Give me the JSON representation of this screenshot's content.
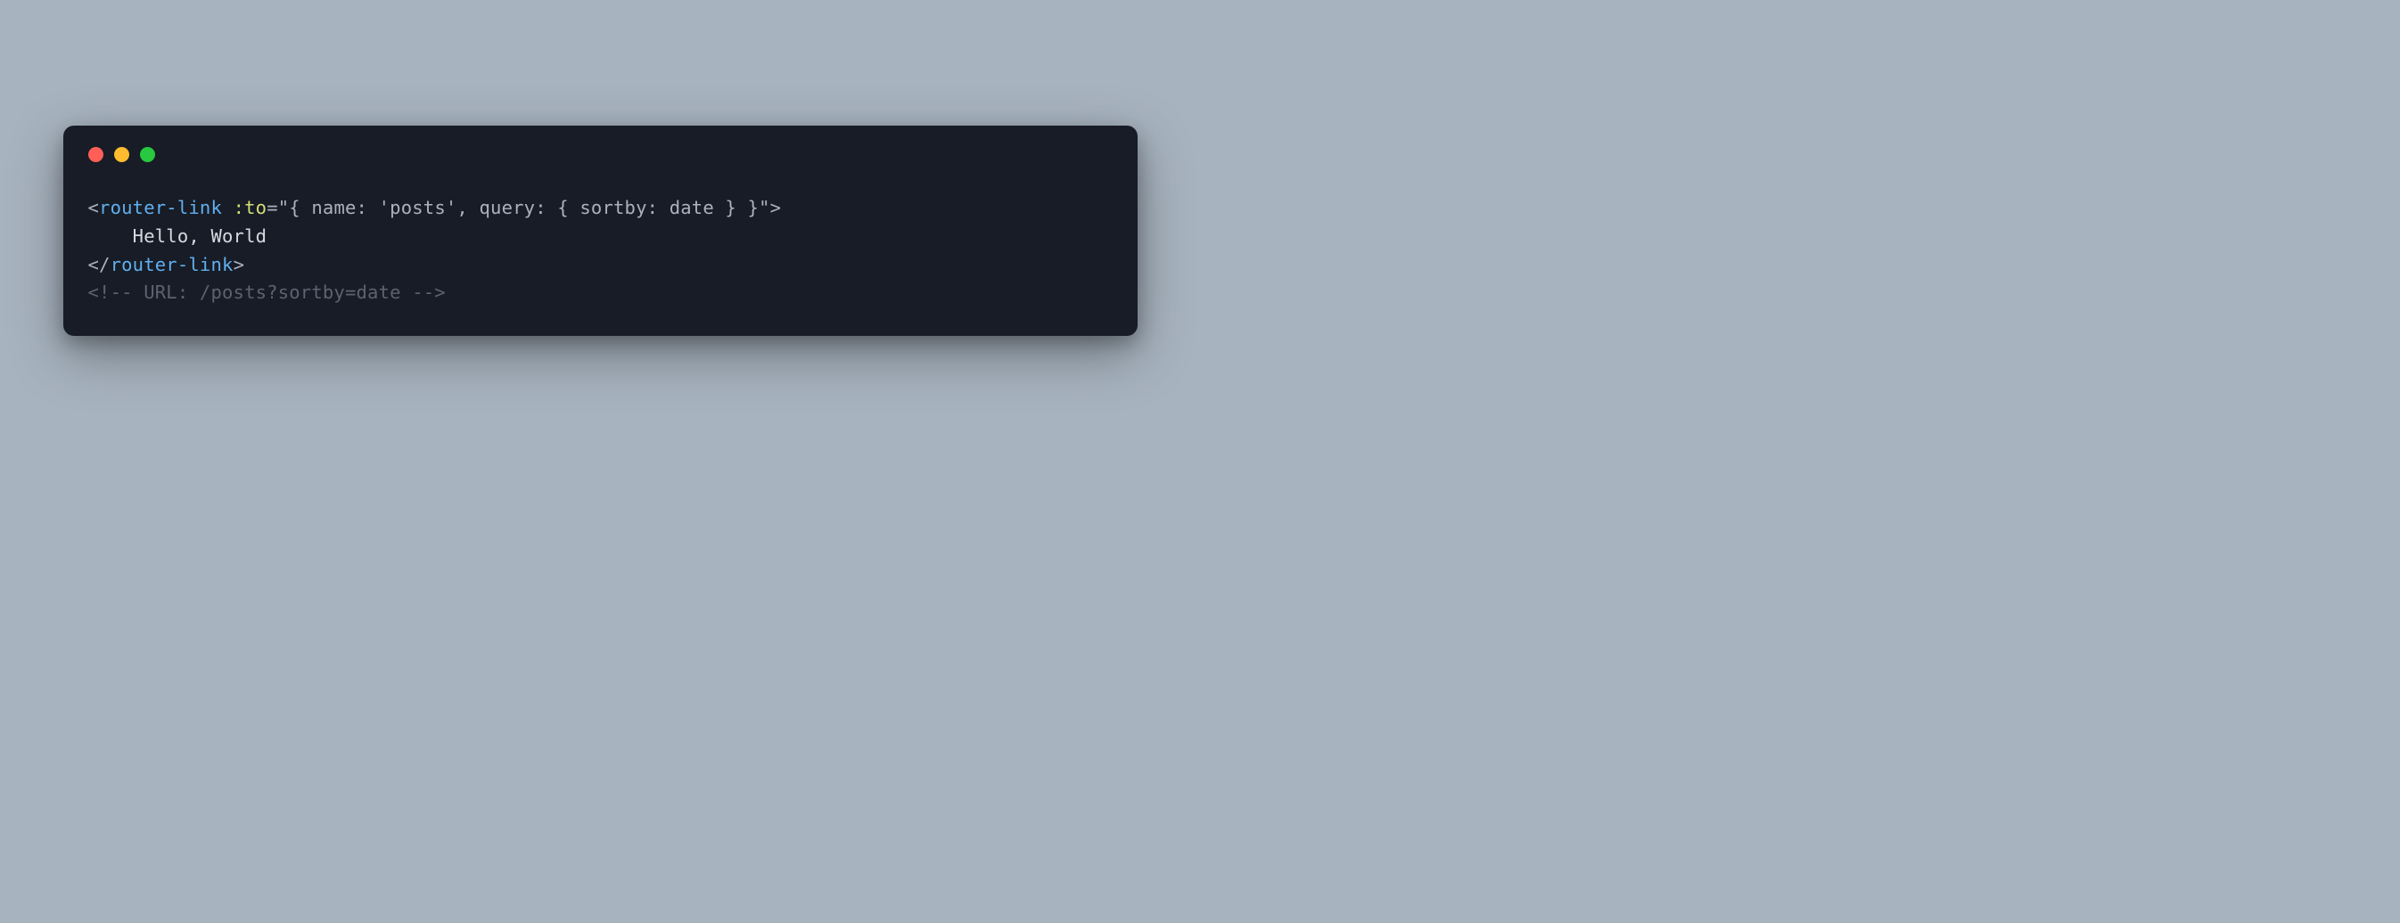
{
  "window": {
    "dots": {
      "red": "close",
      "yellow": "minimize",
      "green": "zoom"
    }
  },
  "code": {
    "line1": {
      "open_bracket": "<",
      "tag_name": "router-link",
      "space": " ",
      "attr_name": ":to",
      "eq": "=",
      "quote_open": "\"",
      "attr_value": "{ name: 'posts', query: { sortby: date } }",
      "quote_close": "\"",
      "close_bracket": ">"
    },
    "line2": {
      "indent": "    ",
      "text": "Hello, World"
    },
    "line3": {
      "open_bracket": "</",
      "tag_name": "router-link",
      "close_bracket": ">"
    },
    "line4": {
      "comment": "<!-- URL: /posts?sortby=date -->"
    }
  }
}
